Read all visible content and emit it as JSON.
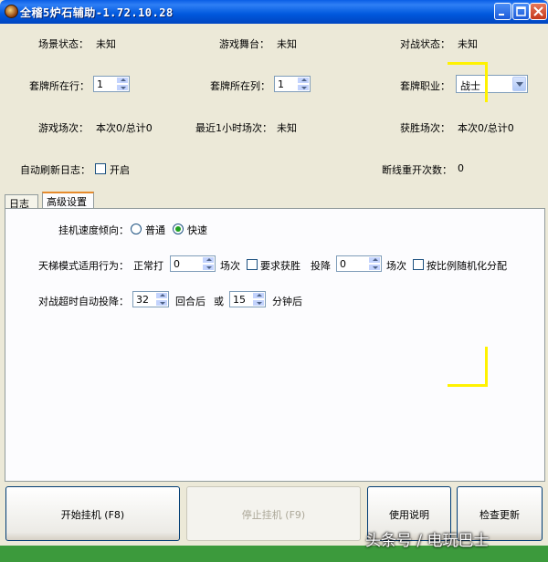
{
  "window": {
    "title": "全稽5炉石辅助-1.72.10.28"
  },
  "status": {
    "scene_label": "场景状态：",
    "scene_value": "未知",
    "board_label": "游戏舞台：",
    "board_value": "未知",
    "battle_label": "对战状态：",
    "battle_value": "未知"
  },
  "deck": {
    "row_label": "套牌所在行：",
    "row_value": "1",
    "col_label": "套牌所在列：",
    "col_value": "1",
    "class_label": "套牌职业：",
    "class_value": "战士"
  },
  "stats": {
    "games_label": "游戏场次：",
    "games_value": "本次0/总计0",
    "recent_label": "最近1小时场次：",
    "recent_value": "未知",
    "wins_label": "获胜场次：",
    "wins_value": "本次0/总计0"
  },
  "log_refresh": {
    "label": "自动刷新日志：",
    "checkbox_label": "开启",
    "reconnect_label": "断线重开次数：",
    "reconnect_value": "0"
  },
  "tabs": [
    {
      "label": "日志"
    },
    {
      "label": "高级设置"
    }
  ],
  "advanced": {
    "speed_label": "挂机速度倾向：",
    "speed_normal": "普通",
    "speed_fast": "快速",
    "ladder_label": "天梯模式适用行为：",
    "normal_play": "正常打",
    "normal_value": "0",
    "games_unit": "场次",
    "require_win": "要求获胜",
    "surrender": "投降",
    "surrender_value": "0",
    "games_unit2": "场次",
    "random_ratio": "按比例随机化分配",
    "timeout_label": "对战超时自动投降：",
    "rounds_value": "32",
    "rounds_after": "回合后",
    "or": "或",
    "minutes_value": "15",
    "minutes_after": "分钟后"
  },
  "buttons": {
    "start": "开始挂机 (F8)",
    "stop": "停止挂机 (F9)",
    "help": "使用说明",
    "update": "检查更新"
  },
  "watermark": {
    "main": "头条号 / 电玩巴士"
  }
}
